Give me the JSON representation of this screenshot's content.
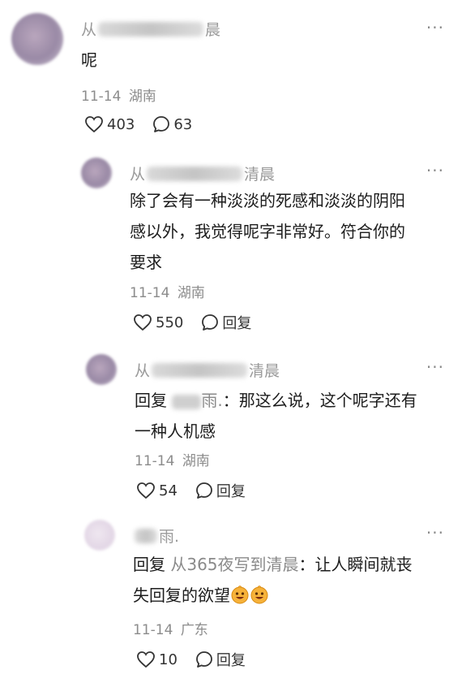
{
  "comments": [
    {
      "name_prefix": "从",
      "name_suffix": "晨",
      "text": "呢",
      "date": "11-14",
      "location": "湖南",
      "likes": "403",
      "replies": "63"
    },
    {
      "name_prefix": "从",
      "name_suffix": "清晨",
      "text_line1": "除了会有一种淡淡的死感和淡淡的阴阳",
      "text_line2": "感以外，我觉得呢字非常好。符合你的",
      "text_line3": "要求",
      "date": "11-14",
      "location": "湖南",
      "likes": "550",
      "reply_label": "回复"
    },
    {
      "name_prefix": "从",
      "name_suffix": "清晨",
      "reply_keyword": "回复",
      "mention_suffix": "雨.",
      "text_line1": "：那这么说，这个呢字还有",
      "text_line2": "一种人机感",
      "date": "11-14",
      "location": "湖南",
      "likes": "54",
      "reply_label": "回复"
    },
    {
      "name_suffix": "雨.",
      "reply_keyword": "回复",
      "mention": "从365夜写到清晨",
      "text_line1": "：让人瞬间就丧",
      "text_line2": "失回复的欲望",
      "emojis": [
        "grinning-face-emoji",
        "grinning-face-emoji"
      ],
      "date": "11-14",
      "location": "广东",
      "likes": "10",
      "reply_label": "回复"
    }
  ],
  "more_glyph": "···",
  "icons": {
    "like": "heart-outline-icon",
    "comment": "speech-bubble-icon",
    "more": "more-dots-icon"
  },
  "colors": {
    "meta": "#8c8c8c",
    "text": "#1c1c1c",
    "mention": "#8a8a8a"
  }
}
